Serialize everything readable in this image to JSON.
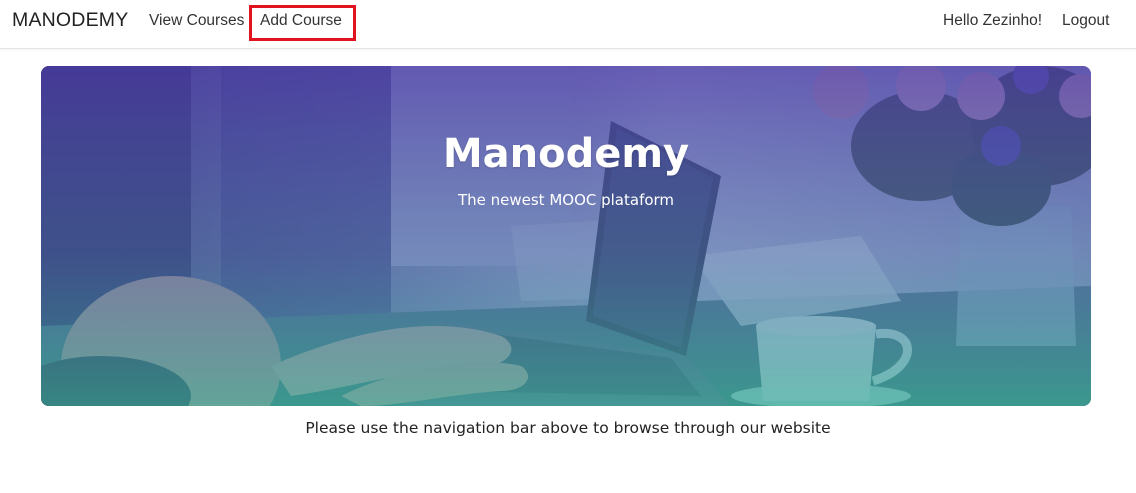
{
  "navbar": {
    "brand": "MANODEMY",
    "view_courses": "View Courses",
    "add_course": "Add Course",
    "greeting": "Hello Zezinho!",
    "logout": "Logout"
  },
  "hero": {
    "title": "Manodemy",
    "subtitle": "The newest MOOC plataform"
  },
  "main": {
    "message": "Please use the navigation bar above to browse through our website"
  },
  "colors": {
    "highlight_border": "#e0141e",
    "hero_overlay_top": "#5a4fbf",
    "hero_overlay_bottom": "#3aa89a"
  }
}
